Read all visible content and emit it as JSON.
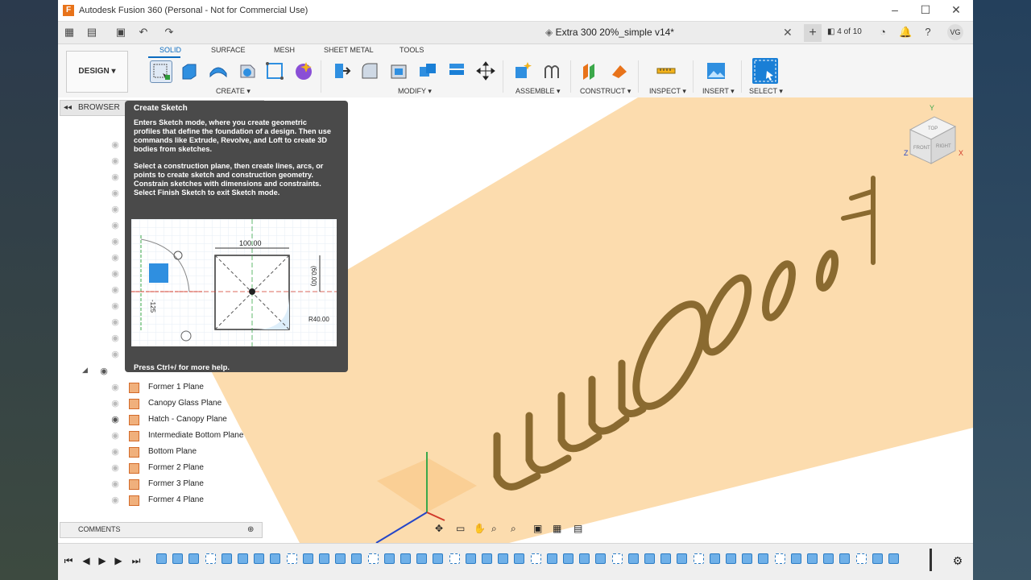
{
  "window": {
    "title": "Autodesk Fusion 360 (Personal - Not for Commercial Use)",
    "logo_letter": "F"
  },
  "quickbar": {
    "document_tab": "Extra 300 20%_simple v14*",
    "jobs": "4 of 10",
    "user_initials": "VG"
  },
  "ribbon": {
    "workspace": "DESIGN ▾",
    "tabs": [
      "SOLID",
      "SURFACE",
      "MESH",
      "SHEET METAL",
      "TOOLS"
    ],
    "groups": [
      "CREATE ▾",
      "MODIFY ▾",
      "ASSEMBLE ▾",
      "CONSTRUCT ▾",
      "INSPECT ▾",
      "INSERT ▾",
      "SELECT ▾"
    ]
  },
  "browser": {
    "title": "BROWSER",
    "planes": [
      {
        "label": "Former 1 Plane",
        "visible": false
      },
      {
        "label": "Canopy Glass Plane",
        "visible": false
      },
      {
        "label": "Hatch - Canopy Plane",
        "visible": true
      },
      {
        "label": "Intermediate Bottom Plane",
        "visible": false
      },
      {
        "label": "Bottom Plane",
        "visible": false
      },
      {
        "label": "Former 2 Plane",
        "visible": false
      },
      {
        "label": "Former 3 Plane",
        "visible": false
      },
      {
        "label": "Former 4 Plane",
        "visible": false
      }
    ]
  },
  "tooltip": {
    "title": "Create Sketch",
    "para1": "Enters Sketch mode, where you create geometric profiles that define the foundation of a design. Then use commands like Extrude, Revolve, and Loft to create 3D bodies from sketches.",
    "para2": "Select a construction plane, then create lines, arcs, or points to create sketch and construction geometry. Constrain sketches with dimensions and constraints. Select Finish Sketch to exit Sketch mode.",
    "footer": "Press Ctrl+/ for more help.",
    "dim_width": "100.00",
    "dim_height": "(60.00)",
    "dim_radius": "R40.00",
    "dim_side": "-125"
  },
  "comments": {
    "title": "COMMENTS"
  },
  "viewcube": {
    "top": "TOP",
    "front": "FRONT",
    "right": "RIGHT",
    "axis_x": "X",
    "axis_y": "Y",
    "axis_z": "Z"
  },
  "colors": {
    "accent": "#0b6bbf",
    "plane": "#fbd9a8",
    "body": "#8a6a30",
    "tooltip_bg": "#4a4a4a"
  }
}
